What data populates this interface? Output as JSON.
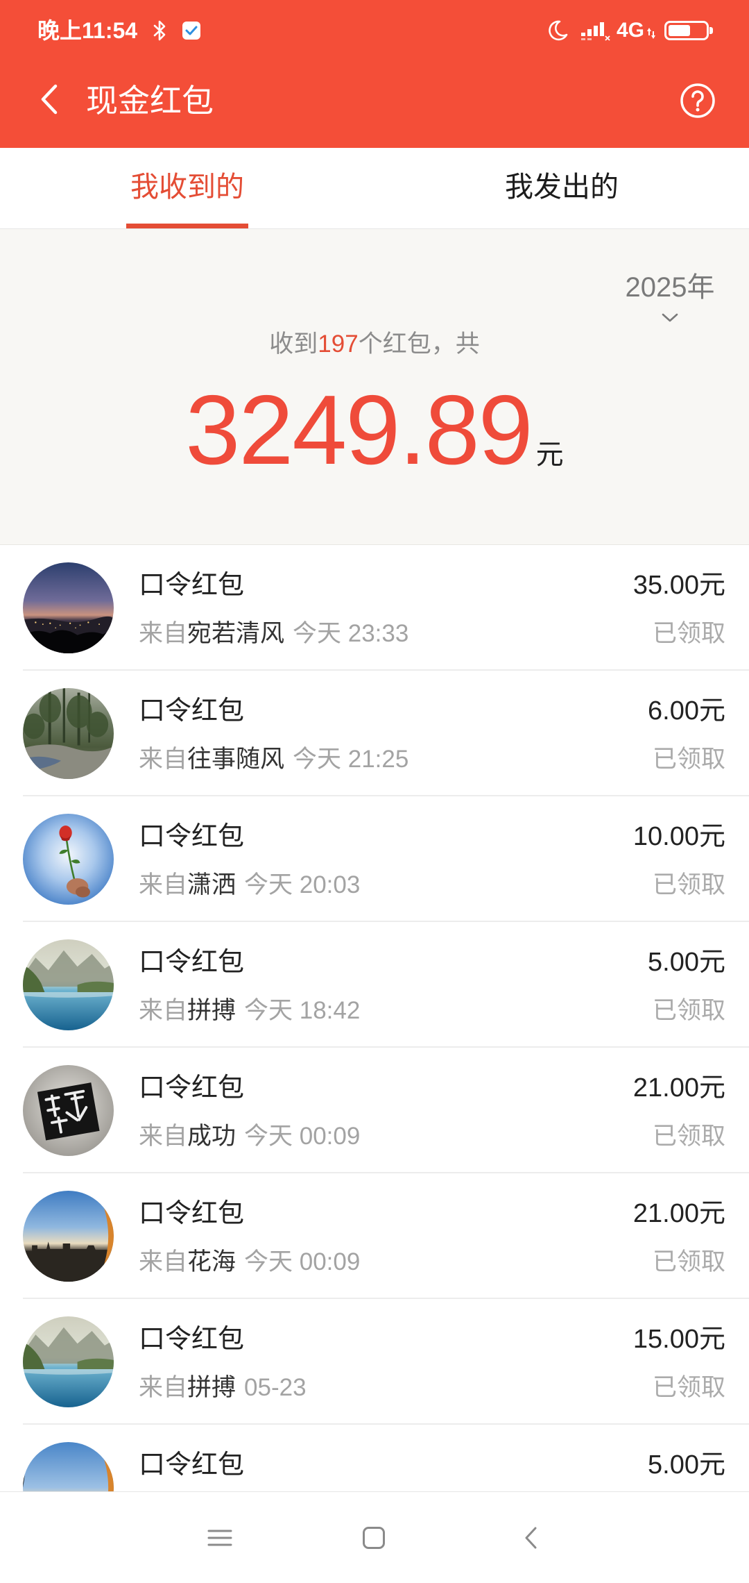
{
  "status_bar": {
    "time": "晚上11:54",
    "network": "4G",
    "battery_level": 60,
    "icons": [
      "bluetooth-icon",
      "notification-app-icon",
      "moon-icon",
      "signal-icon",
      "data-arrows-icon",
      "battery-icon"
    ]
  },
  "header": {
    "title": "现金红包",
    "icons": [
      "back-arrow-icon",
      "help-icon"
    ]
  },
  "tabs": [
    {
      "label": "我收到的",
      "active": true
    },
    {
      "label": "我发出的",
      "active": false
    }
  ],
  "summary": {
    "year": "2025年",
    "count_prefix": "收到",
    "count": "197",
    "count_suffix": "个红包，共",
    "total": "3249.89",
    "unit": "元"
  },
  "list": {
    "from_label": "来自",
    "items": [
      {
        "title": "口令红包",
        "sender": "宛若清风",
        "time": "今天 23:33",
        "amount": "35.00元",
        "status": "已领取"
      },
      {
        "title": "口令红包",
        "sender": "往事随风",
        "time": "今天 21:25",
        "amount": "6.00元",
        "status": "已领取"
      },
      {
        "title": "口令红包",
        "sender": "潇洒",
        "time": "今天 20:03",
        "amount": "10.00元",
        "status": "已领取"
      },
      {
        "title": "口令红包",
        "sender": "拼搏",
        "time": "今天 18:42",
        "amount": "5.00元",
        "status": "已领取"
      },
      {
        "title": "口令红包",
        "sender": "成功",
        "time": "今天 00:09",
        "amount": "21.00元",
        "status": "已领取"
      },
      {
        "title": "口令红包",
        "sender": "花海",
        "time": "今天 00:09",
        "amount": "21.00元",
        "status": "已领取"
      },
      {
        "title": "口令红包",
        "sender": "拼搏",
        "time": "05-23",
        "amount": "15.00元",
        "status": "已领取"
      },
      {
        "title": "口令红包",
        "amount": "5.00元"
      }
    ]
  },
  "nav_bar": {
    "icons": [
      "menu-icon",
      "home-icon",
      "back-icon"
    ]
  },
  "colors": {
    "header_red": "#f44e38",
    "accent_red": "#e44d35",
    "amount_red": "#ef4b3a",
    "summary_bg": "#f8f7f4"
  }
}
